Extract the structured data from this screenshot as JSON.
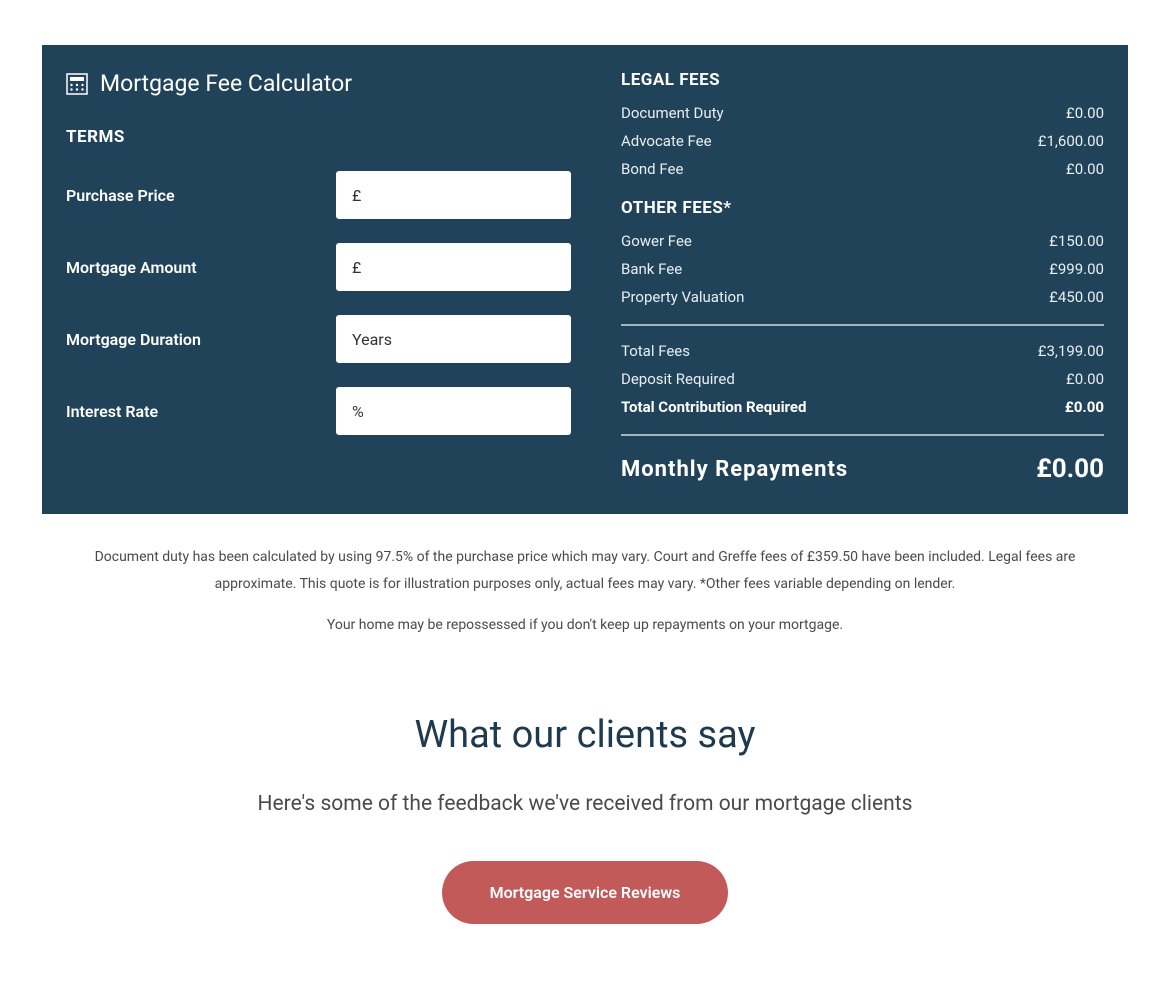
{
  "calculator": {
    "title": "Mortgage Fee Calculator",
    "terms_heading": "TERMS",
    "fields": {
      "purchase_price": {
        "label": "Purchase Price",
        "placeholder": "£"
      },
      "mortgage_amount": {
        "label": "Mortgage Amount",
        "placeholder": "£"
      },
      "mortgage_duration": {
        "label": "Mortgage Duration",
        "placeholder": "Years"
      },
      "interest_rate": {
        "label": "Interest Rate",
        "placeholder": "%"
      }
    },
    "legal_fees_heading": "LEGAL FEES",
    "legal_fees": {
      "document_duty": {
        "label": "Document Duty",
        "value": "£0.00"
      },
      "advocate_fee": {
        "label": "Advocate Fee",
        "value": "£1,600.00"
      },
      "bond_fee": {
        "label": "Bond Fee",
        "value": "£0.00"
      }
    },
    "other_fees_heading": "OTHER FEES*",
    "other_fees": {
      "gower_fee": {
        "label": "Gower Fee",
        "value": "£150.00"
      },
      "bank_fee": {
        "label": "Bank Fee",
        "value": "£999.00"
      },
      "property_valuation": {
        "label": "Property Valuation",
        "value": "£450.00"
      }
    },
    "totals": {
      "total_fees": {
        "label": "Total Fees",
        "value": "£3,199.00"
      },
      "deposit_required": {
        "label": "Deposit Required",
        "value": "£0.00"
      },
      "total_contribution": {
        "label": "Total Contribution Required",
        "value": "£0.00"
      }
    },
    "monthly": {
      "label": "Monthly Repayments",
      "value": "£0.00"
    }
  },
  "disclaimer": {
    "line1": "Document duty has been calculated by using 97.5% of the purchase price which may vary. Court and Greffe fees of £359.50 have been included. Legal fees are approximate. This quote is for illustration purposes only, actual fees may vary. *Other fees variable depending on lender.",
    "line2": "Your home may be repossessed if you don't keep up repayments on your mortgage."
  },
  "clients": {
    "title": "What our clients say",
    "subtitle": "Here's some of the feedback we've received from our mortgage clients",
    "button_label": "Mortgage Service Reviews"
  }
}
